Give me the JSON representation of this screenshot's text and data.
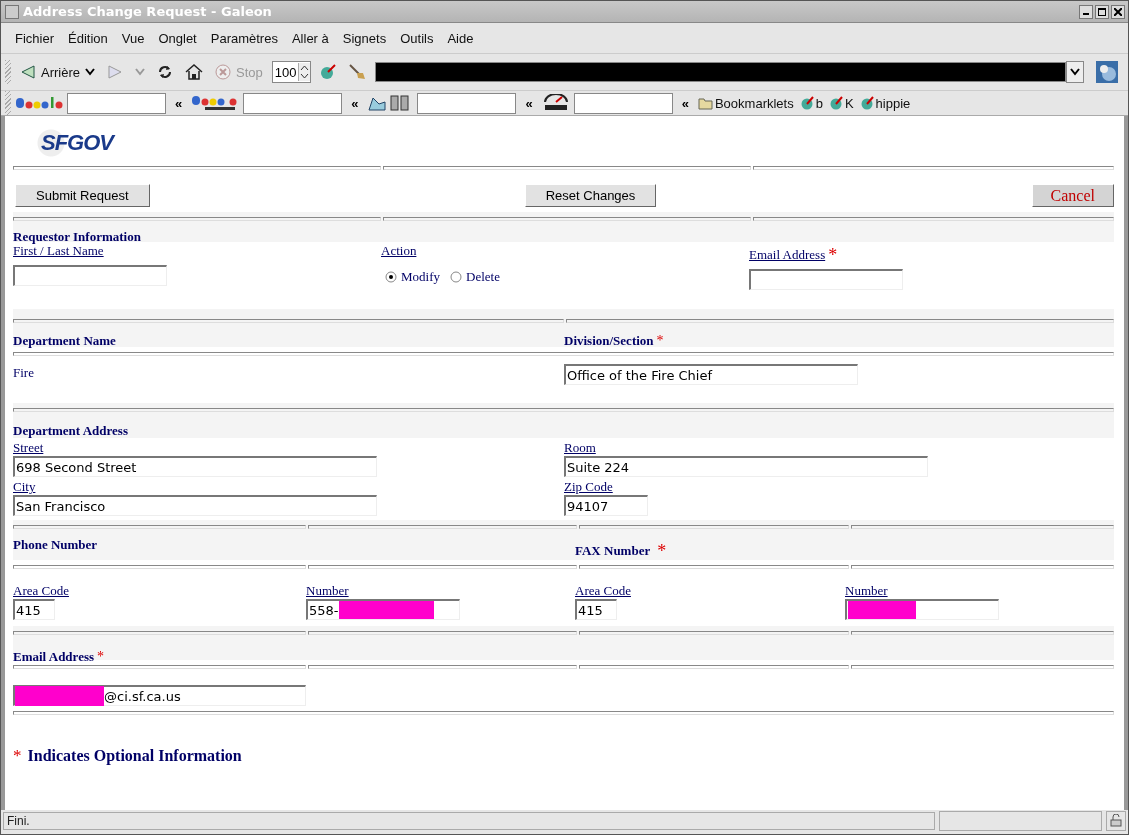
{
  "window": {
    "title": "Address Change Request - Galeon"
  },
  "menu": [
    {
      "label": "Fichier"
    },
    {
      "label": "Édition"
    },
    {
      "label": "Vue"
    },
    {
      "label": "Onglet"
    },
    {
      "label": "Paramètres"
    },
    {
      "label": "Aller à"
    },
    {
      "label": "Signets"
    },
    {
      "label": "Outils"
    },
    {
      "label": "Aide"
    }
  ],
  "toolbar": {
    "back": "Arrière",
    "stop": "Stop",
    "zoom": "100",
    "address": {
      "redacted": true
    }
  },
  "search_bar": {
    "bookmarks": [
      {
        "label": "Bookmarklets",
        "kind": "folder"
      },
      {
        "label": "b",
        "kind": "bookmarklet"
      },
      {
        "label": "K",
        "kind": "bookmarklet"
      },
      {
        "label": "hippie",
        "kind": "bookmarklet"
      }
    ],
    "separator": "«"
  },
  "logo": {
    "text": "SFGOV"
  },
  "form": {
    "buttons": {
      "submit": "Submit Request",
      "reset": "Reset Changes",
      "cancel": "Cancel"
    },
    "requestor": {
      "heading": "Requestor Information",
      "name_label": "First / Last Name",
      "action_label": "Action",
      "actions": [
        {
          "label": "Modify",
          "selected": true
        },
        {
          "label": "Delete",
          "selected": false
        }
      ],
      "email_label": "Email Address",
      "email_mark": "*"
    },
    "department": {
      "name_heading": "Department Name",
      "division_heading": "Division/Section",
      "division_mark": "*",
      "name_value": "Fire",
      "division_value": "Office of the Fire Chief"
    },
    "address": {
      "heading": "Department Address",
      "fields": [
        {
          "label": "Street",
          "value": "698 Second Street"
        },
        {
          "label": "Room",
          "value": "Suite 224"
        },
        {
          "label": "City",
          "value": "San Francisco"
        },
        {
          "label": "Zip Code",
          "value": "94107"
        }
      ]
    },
    "phone": {
      "heading": "Phone Number",
      "fax_heading": "FAX Number",
      "fax_mark": "*",
      "fields": [
        {
          "label": "Area Code",
          "value": "415",
          "redacted": false
        },
        {
          "label": "Number",
          "value": "558-",
          "redacted": true
        },
        {
          "label": "Area Code",
          "value": "415",
          "redacted": false
        },
        {
          "label": "Number",
          "redacted": true
        }
      ]
    },
    "email": {
      "heading": "Email Address",
      "mark": "*",
      "value": "@ci.sf.ca.us",
      "redacted": true
    },
    "footnote": {
      "mark": "*",
      "text": "Indicates Optional Information"
    }
  },
  "status_bar": {
    "text": "Fini."
  }
}
